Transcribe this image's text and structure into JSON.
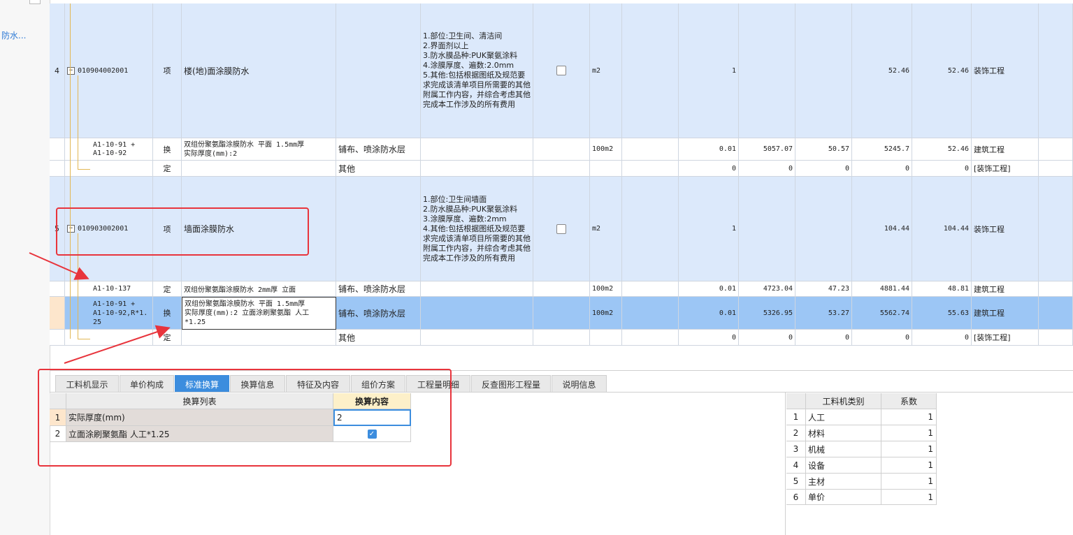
{
  "left_panel": {
    "link": "防水..."
  },
  "rows": [
    {
      "no": "4",
      "code": "010904002001",
      "type": "项",
      "name": "楼(地)面涂膜防水",
      "content": "",
      "features": "1.部位:卫生间、清洁间\n2.界面剂以上\n3.防水膜品种:PUK聚氨涂料\n4.涂膜厚度、遍数:2.0mm\n5.其他:包括根据图纸及规范要求完成该清单项目所需要的其他附属工作内容，并综合考虑其他完成本工作涉及的所有费用",
      "unit": "m2",
      "qty": "1",
      "p1": "",
      "p2": "",
      "p3": "52.46",
      "p4": "52.46",
      "prof": "装饰工程"
    },
    {
      "no": "",
      "code": "A1-10-91 +\nA1-10-92",
      "type": "换",
      "name": "双组份聚氨酯涂膜防水 平面 1.5mm厚\n实际厚度(mm):2",
      "content": "铺布、喷涂防水层",
      "features": "",
      "unit": "100m2",
      "qty": "0.01",
      "p1": "5057.07",
      "p2": "50.57",
      "p3": "5245.7",
      "p4": "52.46",
      "prof": "建筑工程"
    },
    {
      "no": "",
      "code": "",
      "type": "定",
      "name": "",
      "content": "其他",
      "features": "",
      "unit": "",
      "qty": "0",
      "p1": "0",
      "p2": "0",
      "p3": "0",
      "p4": "0",
      "prof": "[装饰工程]"
    },
    {
      "no": "5",
      "code": "010903002001",
      "type": "项",
      "name": "墙面涂膜防水",
      "content": "",
      "features": "1.部位:卫生间墙面\n2.防水膜品种:PUK聚氨涂料\n3.涂膜厚度、遍数:2mm\n4.其他:包括根据图纸及规范要求完成该清单项目所需要的其他附属工作内容，并综合考虑其他完成本工作涉及的所有费用",
      "unit": "m2",
      "qty": "1",
      "p1": "",
      "p2": "",
      "p3": "104.44",
      "p4": "104.44",
      "prof": "装饰工程"
    },
    {
      "no": "",
      "code": "A1-10-137",
      "type": "定",
      "name": "双组份聚氨酯涂膜防水 2mm厚 立面",
      "content": "铺布、喷涂防水层",
      "features": "",
      "unit": "100m2",
      "qty": "0.01",
      "p1": "4723.04",
      "p2": "47.23",
      "p3": "4881.44",
      "p4": "48.81",
      "prof": "建筑工程"
    },
    {
      "no": "",
      "code": "A1-10-91 +\nA1-10-92,R*1.\n25",
      "type": "换",
      "name": "双组份聚氨酯涂膜防水 平面 1.5mm厚\n实际厚度(mm):2  立面涂刷聚氨酯 人工\n*1.25",
      "content": "铺布、喷涂防水层",
      "features": "",
      "unit": "100m2",
      "qty": "0.01",
      "p1": "5326.95",
      "p2": "53.27",
      "p3": "5562.74",
      "p4": "55.63",
      "prof": "建筑工程"
    },
    {
      "no": "",
      "code": "",
      "type": "定",
      "name": "",
      "content": "其他",
      "features": "",
      "unit": "",
      "qty": "0",
      "p1": "0",
      "p2": "0",
      "p3": "0",
      "p4": "0",
      "prof": "[装饰工程]"
    }
  ],
  "tabs": [
    "工料机显示",
    "单价构成",
    "标准换算",
    "换算信息",
    "特征及内容",
    "组价方案",
    "工程量明细",
    "反查图形工程量",
    "说明信息"
  ],
  "active_tab": "标准换算",
  "conv_table": {
    "headers": [
      "换算列表",
      "换算内容"
    ],
    "rows": [
      {
        "no": "1",
        "item": "实际厚度(mm)",
        "value": "2"
      },
      {
        "no": "2",
        "item": "立面涂刷聚氨酯 人工*1.25",
        "checked": true
      }
    ]
  },
  "coef_table": {
    "headers": [
      "工料机类别",
      "系数"
    ],
    "rows": [
      {
        "no": "1",
        "cat": "人工",
        "coef": "1"
      },
      {
        "no": "2",
        "cat": "材料",
        "coef": "1"
      },
      {
        "no": "3",
        "cat": "机械",
        "coef": "1"
      },
      {
        "no": "4",
        "cat": "设备",
        "coef": "1"
      },
      {
        "no": "5",
        "cat": "主材",
        "coef": "1"
      },
      {
        "no": "6",
        "cat": "单价",
        "coef": "1"
      }
    ]
  }
}
